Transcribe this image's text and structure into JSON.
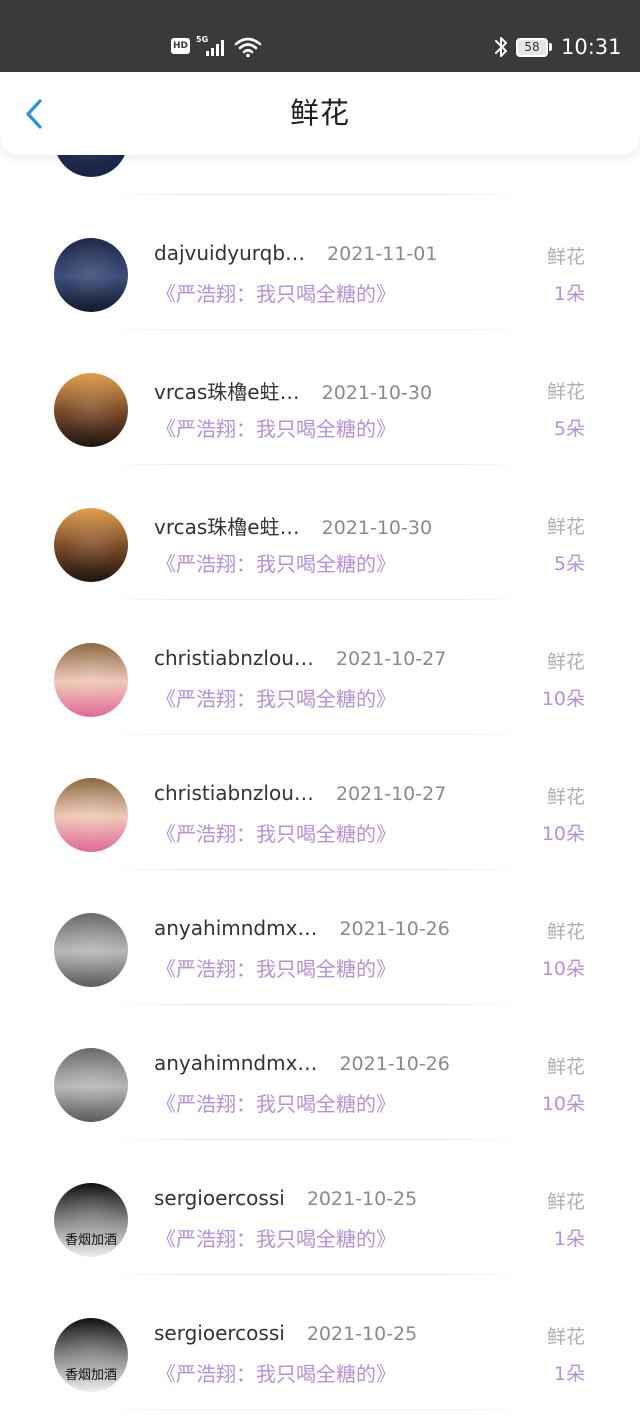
{
  "status_bar": {
    "hd": "HD",
    "network": "5G",
    "battery": "58",
    "time": "10:31",
    "icons": [
      "signal-icon",
      "wifi-icon",
      "bluetooth-icon",
      "battery-icon"
    ]
  },
  "header": {
    "title": "鲜花",
    "back_icon": "chevron-left-icon",
    "accent": "#2196d8"
  },
  "colors": {
    "purple": "#b690dc",
    "status_bg": "#3a3a3a"
  },
  "list": {
    "partial_top_avatar": {
      "colors": [
        "#2a3a6a",
        "#24305a",
        "#1a2244"
      ]
    },
    "items": [
      {
        "name": "dajvuidyurqb…",
        "date": "2021-11-01",
        "label": "鲜花",
        "subtitle": "《严浩翔：我只喝全糖的》",
        "count": "1朵",
        "avatar": {
          "colors": [
            "#1e2a4a",
            "#3d4d7a",
            "#141a2e"
          ]
        }
      },
      {
        "name": "vrcas珠櫓e蛀…",
        "date": "2021-10-30",
        "label": "鲜花",
        "subtitle": "《严浩翔：我只喝全糖的》",
        "count": "5朵",
        "avatar": {
          "colors": [
            "#e3a050",
            "#7a4a28",
            "#1c1510"
          ]
        }
      },
      {
        "name": "vrcas珠櫓e蛀…",
        "date": "2021-10-30",
        "label": "鲜花",
        "subtitle": "《严浩翔：我只喝全糖的》",
        "count": "5朵",
        "avatar": {
          "colors": [
            "#e3a050",
            "#7a4a28",
            "#1c1510"
          ]
        }
      },
      {
        "name": "christiabnzlou…",
        "date": "2021-10-27",
        "label": "鲜花",
        "subtitle": "《严浩翔：我只喝全糖的》",
        "count": "10朵",
        "avatar": {
          "colors": [
            "#8a6a40",
            "#f0c8b8",
            "#e06a98"
          ]
        }
      },
      {
        "name": "christiabnzlou…",
        "date": "2021-10-27",
        "label": "鲜花",
        "subtitle": "《严浩翔：我只喝全糖的》",
        "count": "10朵",
        "avatar": {
          "colors": [
            "#8a6a40",
            "#f0c8b8",
            "#e06a98"
          ]
        }
      },
      {
        "name": "anyahimndmx…",
        "date": "2021-10-26",
        "label": "鲜花",
        "subtitle": "《严浩翔：我只喝全糖的》",
        "count": "10朵",
        "avatar": {
          "colors": [
            "#6a6a6a",
            "#b8b8b8",
            "#5a5a5a"
          ]
        }
      },
      {
        "name": "anyahimndmx…",
        "date": "2021-10-26",
        "label": "鲜花",
        "subtitle": "《严浩翔：我只喝全糖的》",
        "count": "10朵",
        "avatar": {
          "colors": [
            "#6a6a6a",
            "#b8b8b8",
            "#5a5a5a"
          ]
        }
      },
      {
        "name": "sergioercossi",
        "date": "2021-10-25",
        "label": "鲜花",
        "subtitle": "《严浩翔：我只喝全糖的》",
        "count": "1朵",
        "avatar": {
          "colors": [
            "#101010",
            "#8a8a8a",
            "#eeeeee"
          ],
          "caption": "香烟加酒"
        }
      },
      {
        "name": "sergioercossi",
        "date": "2021-10-25",
        "label": "鲜花",
        "subtitle": "《严浩翔：我只喝全糖的》",
        "count": "1朵",
        "avatar": {
          "colors": [
            "#101010",
            "#8a8a8a",
            "#eeeeee"
          ],
          "caption": "香烟加酒"
        }
      }
    ]
  }
}
